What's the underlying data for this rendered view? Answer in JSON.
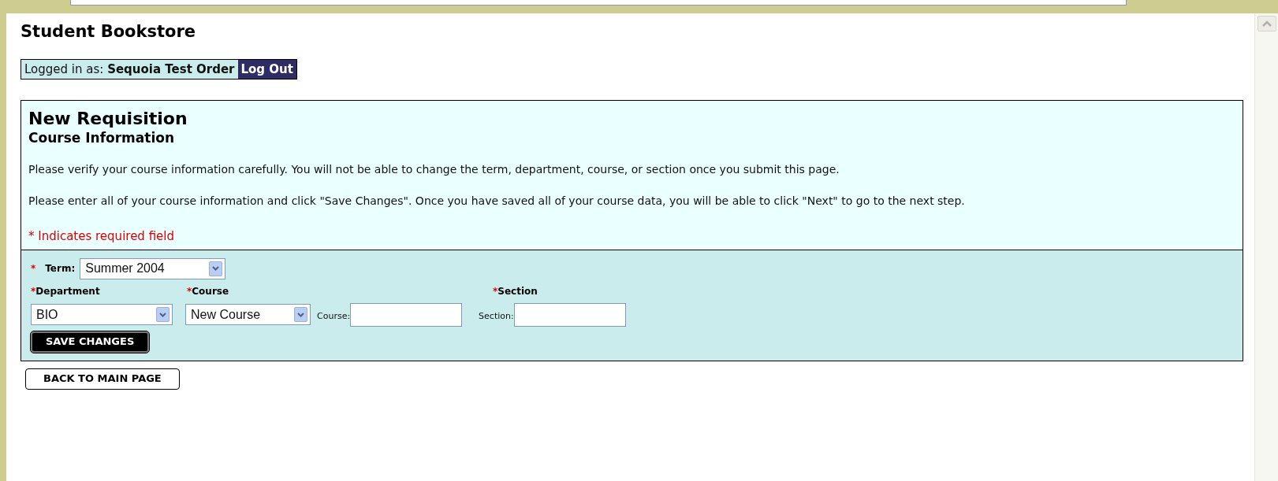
{
  "site_title": "Student Bookstore",
  "login": {
    "label": "Logged in as:",
    "user": "Sequoia Test Order",
    "logout": "Log Out"
  },
  "panel": {
    "title": "New Requisition",
    "subtitle": "Course Information",
    "paragraphs": [
      "Please verify your course information carefully. You will not be able to change the term, department, course, or section once you submit this page.",
      "Please enter all of your course information and click \"Save Changes\". Once you have saved all of your course data, you will be able to click \"Next\" to go to the next step."
    ],
    "required_mark": "*",
    "required_note": "Indicates required field"
  },
  "form": {
    "term": {
      "label": "Term:",
      "value": "Summer 2004"
    },
    "department": {
      "label": "Department",
      "value": "BIO"
    },
    "course": {
      "label": "Course",
      "value": "New Course",
      "field_label": "Course:"
    },
    "section": {
      "label": "Section",
      "field_label": "Section:"
    },
    "save_button": "SAVE CHANGES"
  },
  "back_button": "BACK TO MAIN PAGE"
}
